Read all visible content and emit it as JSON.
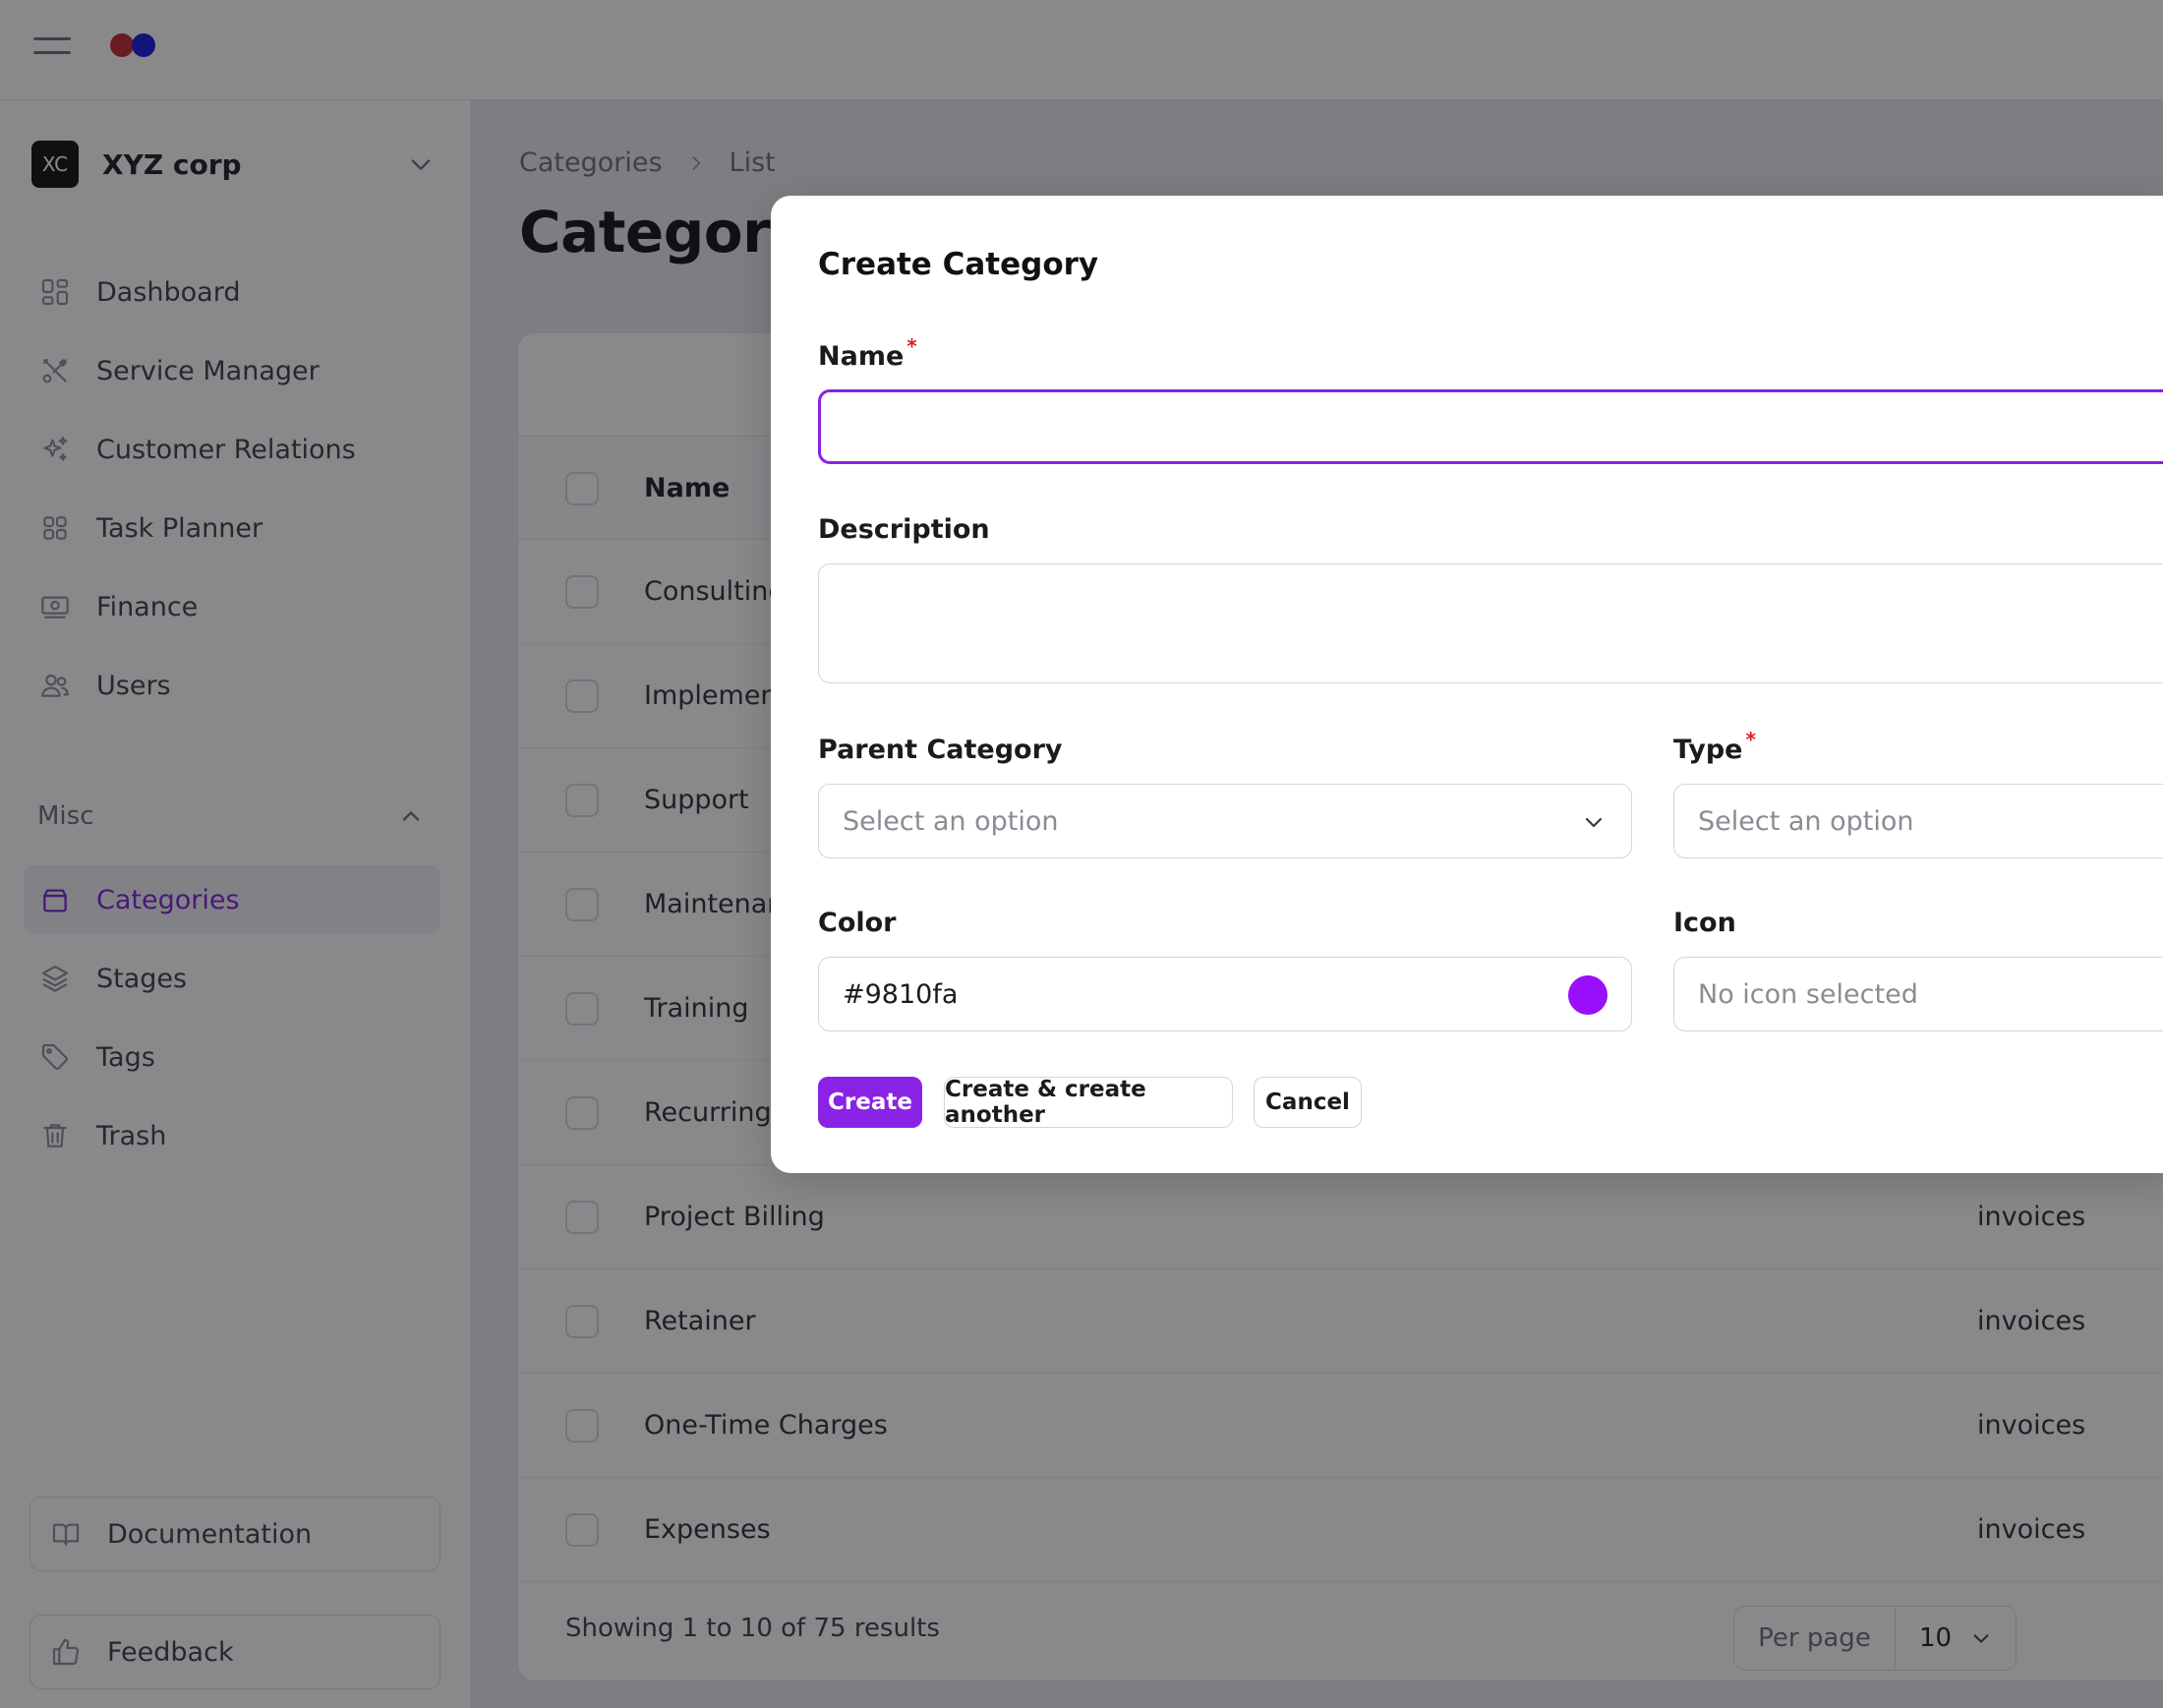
{
  "topbar": {
    "menu_icon": "hamburger-icon",
    "brand_colors": [
      "#c0242a",
      "#1212e0"
    ]
  },
  "sidebar": {
    "company": {
      "initials": "XC",
      "name": "XYZ corp"
    },
    "items": [
      {
        "label": "Dashboard",
        "icon": "grid-icon"
      },
      {
        "label": "Service Manager",
        "icon": "tools-icon"
      },
      {
        "label": "Customer Relations",
        "icon": "sparkles-icon"
      },
      {
        "label": "Task Planner",
        "icon": "squares-icon"
      },
      {
        "label": "Finance",
        "icon": "banknote-icon"
      },
      {
        "label": "Users",
        "icon": "users-icon"
      }
    ],
    "misc": {
      "label": "Misc",
      "items": [
        {
          "label": "Categories",
          "icon": "archive-icon",
          "active": true
        },
        {
          "label": "Stages",
          "icon": "layers-icon"
        },
        {
          "label": "Tags",
          "icon": "tag-icon"
        },
        {
          "label": "Trash",
          "icon": "trash-icon"
        }
      ]
    },
    "documentation_label": "Documentation",
    "feedback_label": "Feedback",
    "active_color": "#7a1dd8"
  },
  "main": {
    "breadcrumb": [
      "Categories",
      "List"
    ],
    "title": "Categorie",
    "table": {
      "header_name": "Name",
      "rows": [
        {
          "name": "Consulting",
          "type": ""
        },
        {
          "name": "Implement",
          "type": ""
        },
        {
          "name": "Support",
          "type": ""
        },
        {
          "name": "Maintenar",
          "type": ""
        },
        {
          "name": "Training",
          "type": ""
        },
        {
          "name": "Recurring",
          "type": ""
        },
        {
          "name": "Project Billing",
          "type": "invoices"
        },
        {
          "name": "Retainer",
          "type": "invoices"
        },
        {
          "name": "One-Time Charges",
          "type": "invoices"
        },
        {
          "name": "Expenses",
          "type": "invoices"
        }
      ],
      "showing": "Showing 1 to 10 of 75 results",
      "per_page_label": "Per page",
      "per_page_value": "10"
    }
  },
  "modal": {
    "title": "Create Category",
    "required_mark": "*",
    "name_label": "Name",
    "name_value": "",
    "description_label": "Description",
    "description_value": "",
    "parent_label": "Parent Category",
    "parent_placeholder": "Select an option",
    "type_label": "Type",
    "type_placeholder": "Select an option",
    "color_label": "Color",
    "color_value": "#9810fa",
    "icon_label": "Icon",
    "icon_placeholder": "No icon selected",
    "buttons": {
      "create": "Create",
      "create_another": "Create & create another",
      "cancel": "Cancel"
    },
    "accent_color": "#8a22e6"
  }
}
